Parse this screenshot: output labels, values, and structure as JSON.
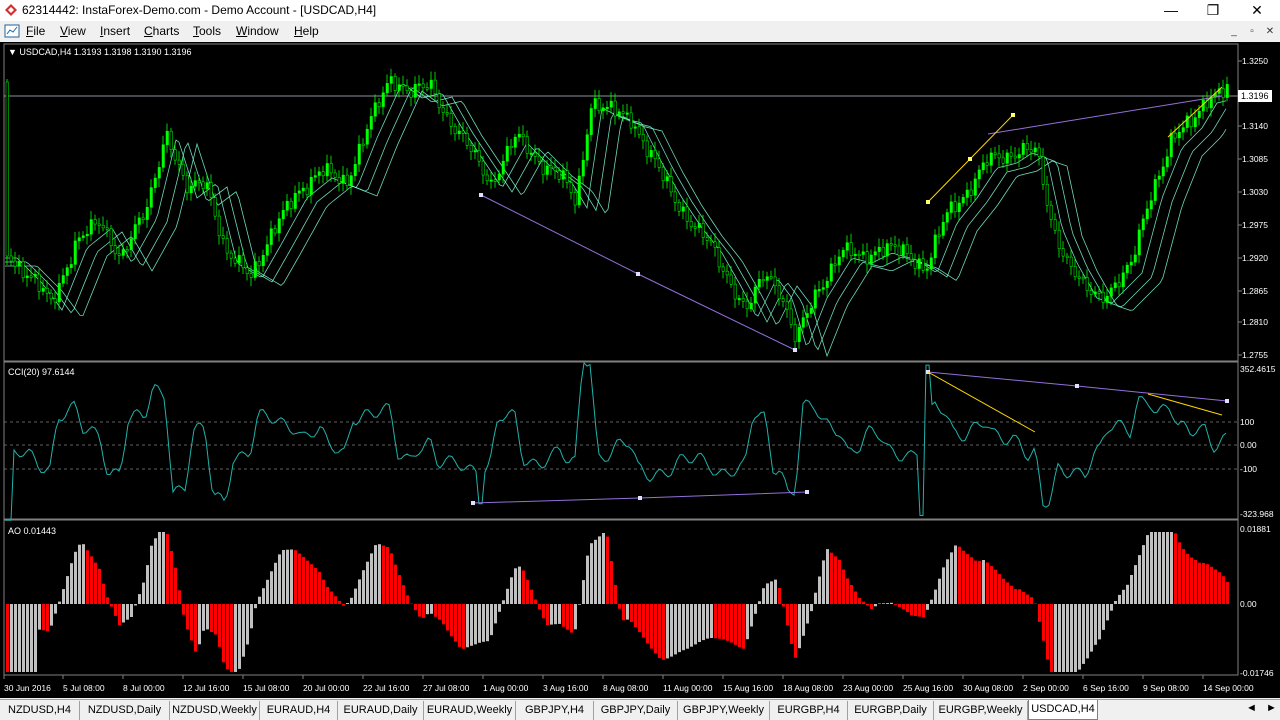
{
  "window": {
    "title": "62314442: InstaForex-Demo.com - Demo Account - [USDCAD,H4]",
    "minimize": "—",
    "maximize": "❐",
    "close": "✕"
  },
  "menu": {
    "items": [
      "File",
      "View",
      "Insert",
      "Charts",
      "Tools",
      "Window",
      "Help"
    ],
    "mdi": [
      "_",
      "▫",
      "✕"
    ]
  },
  "main_chart": {
    "label": "▼ USDCAD,H4  1.3193 1.3198 1.3190 1.3196",
    "price_ticks": [
      "1.3250",
      "1.3140",
      "1.3085",
      "1.3030",
      "1.2975",
      "1.2920",
      "1.2865",
      "1.2810",
      "1.2755"
    ],
    "current_price": "1.3196",
    "colors": {
      "candle": "#00ff00",
      "bands": "#7fffd4",
      "trend_purple": "#9370db",
      "trend_gold": "#ffd700"
    }
  },
  "cci": {
    "label": "CCI(20) 97.6144",
    "ticks": [
      "352.4615",
      "100",
      "0.00",
      "-100",
      "-323.968"
    ],
    "color": "#20b2aa"
  },
  "ao": {
    "label": "AO 0.01443",
    "ticks": [
      "0.01881",
      "0.00",
      "-0.01746"
    ],
    "colors": {
      "up": "#c0c0c0",
      "down": "#ff0000"
    }
  },
  "time_axis": [
    "30 Jun 2016",
    "5 Jul 08:00",
    "8 Jul 00:00",
    "12 Jul 16:00",
    "15 Jul 08:00",
    "20 Jul 00:00",
    "22 Jul 16:00",
    "27 Jul 08:00",
    "1 Aug 00:00",
    "3 Aug 16:00",
    "8 Aug 08:00",
    "11 Aug 00:00",
    "15 Aug 16:00",
    "18 Aug 08:00",
    "23 Aug 00:00",
    "25 Aug 16:00",
    "30 Aug 08:00",
    "2 Sep 00:00",
    "6 Sep 16:00",
    "9 Sep 08:00",
    "14 Sep 00:00"
  ],
  "tabs": [
    "NZDUSD,H4",
    "NZDUSD,Daily",
    "NZDUSD,Weekly",
    "EURAUD,H4",
    "EURAUD,Daily",
    "EURAUD,Weekly",
    "GBPJPY,H4",
    "GBPJPY,Daily",
    "GBPJPY,Weekly",
    "EURGBP,H4",
    "EURGBP,Daily",
    "EURGBP,Weekly",
    "USDCAD,H4"
  ],
  "active_tab": "USDCAD,H4",
  "tab_nav": [
    "◄",
    "►"
  ]
}
